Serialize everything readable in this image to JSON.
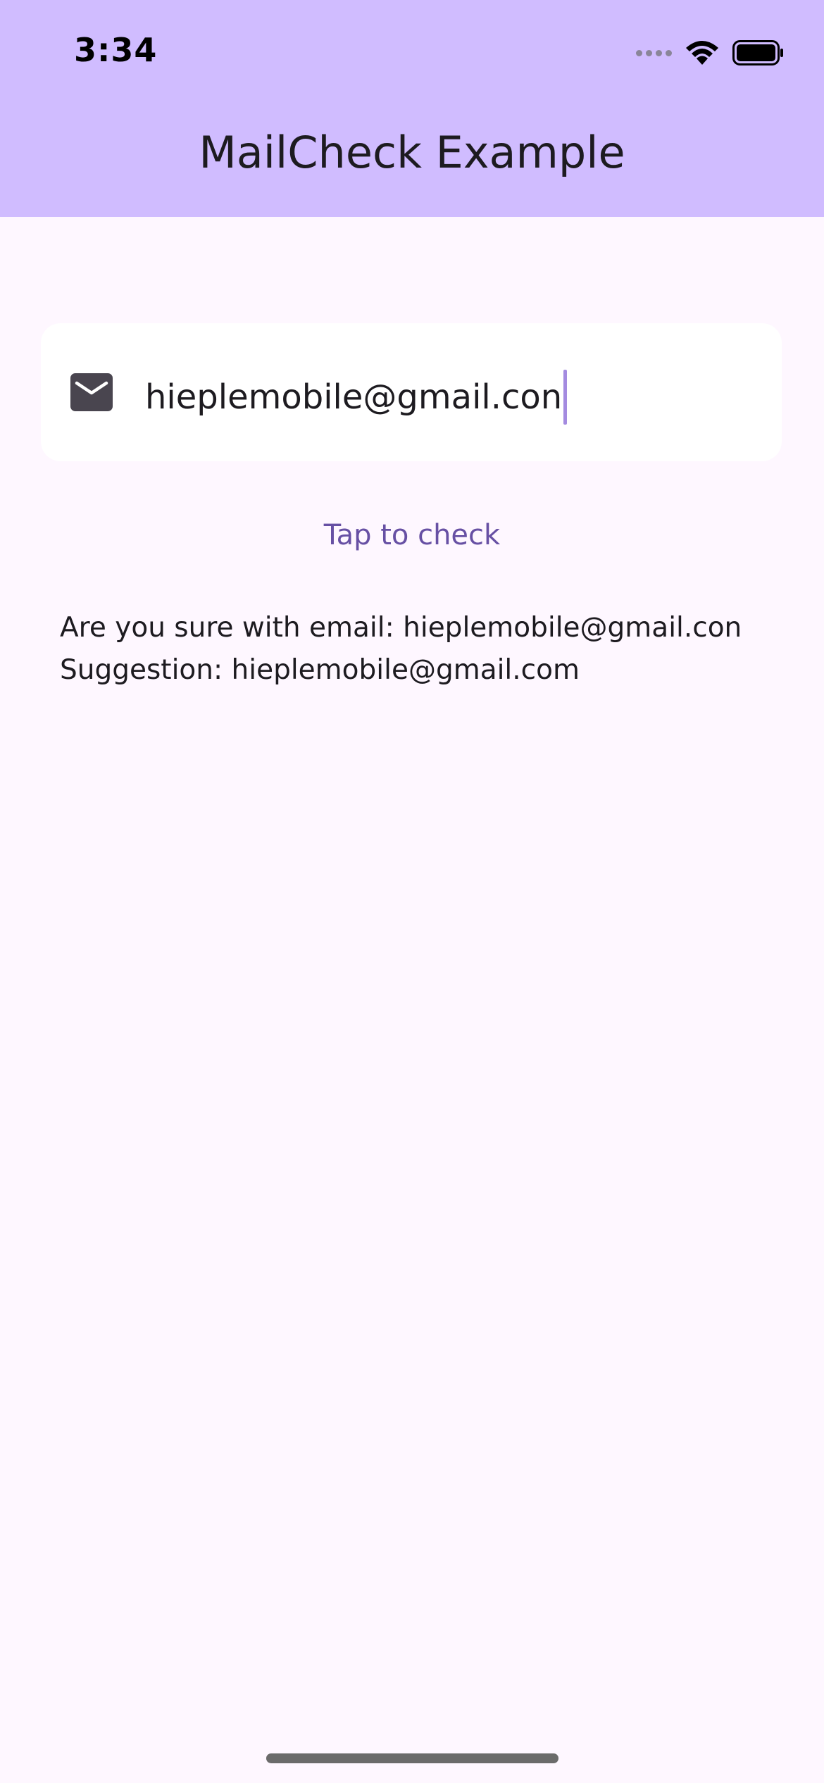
{
  "status_bar": {
    "time": "3:34"
  },
  "app_bar": {
    "title": "MailCheck Example",
    "background_color": "#D0BCFF"
  },
  "email_input": {
    "icon": "mail-icon",
    "value": "hieplemobile@gmail.con"
  },
  "check_button": {
    "label": "Tap to check",
    "color": "#6750A4"
  },
  "result": {
    "line1": "Are you sure with email: hieplemobile@gmail.con",
    "line2": "Suggestion: hieplemobile@gmail.com"
  }
}
